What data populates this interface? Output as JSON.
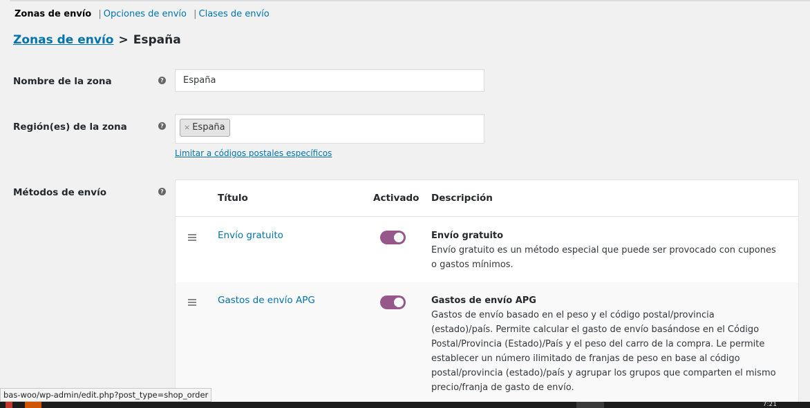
{
  "subnav": {
    "current": "Zonas de envío",
    "separator": "|",
    "link_options": "Opciones de envío",
    "link_classes": "Clases de envío"
  },
  "breadcrumb": {
    "parent": "Zonas de envío",
    "separator": ">",
    "current": "España"
  },
  "form": {
    "zone_name_label": "Nombre de la zona",
    "zone_name_value": "España",
    "regions_label": "Región(es) de la zona",
    "region_chip_remove": "×",
    "region_chip_label": "España",
    "postcodes_link": "Limitar a códigos postales específicos",
    "methods_label": "Métodos de envío",
    "help_glyph": "?"
  },
  "methods_table": {
    "headers": {
      "title": "Título",
      "enabled": "Activado",
      "description": "Descripción"
    },
    "rows": [
      {
        "title": "Envío gratuito",
        "enabled": true,
        "desc_title": "Envío gratuito",
        "desc_text": "Envío gratuito es un método especial que puede ser provocado con cupones o gastos mínimos."
      },
      {
        "title": "Gastos de envío APG",
        "enabled": true,
        "desc_title": "Gastos de envío APG",
        "desc_text": "Gastos de envío basado en el peso y el código postal/provincia (estado)/país. Permite calcular el gasto de envío basándose en el Código Postal/Provincia (Estado)/País y el peso del carro de la compra. Le permite establecer un número ilimitado de franjas de peso en base al código postal/provincia (estado)/país y agrupar los grupos que comparten el mismo precio/franja de gasto de envío."
      }
    ]
  },
  "status_bar": {
    "url": "bas-woo/wp-admin/edit.php?post_type=shop_order"
  },
  "taskbar": {
    "clock": "7:21"
  },
  "colors": {
    "link": "#0073aa",
    "toggle_on": "#96588a",
    "background": "#f1f1f1"
  }
}
